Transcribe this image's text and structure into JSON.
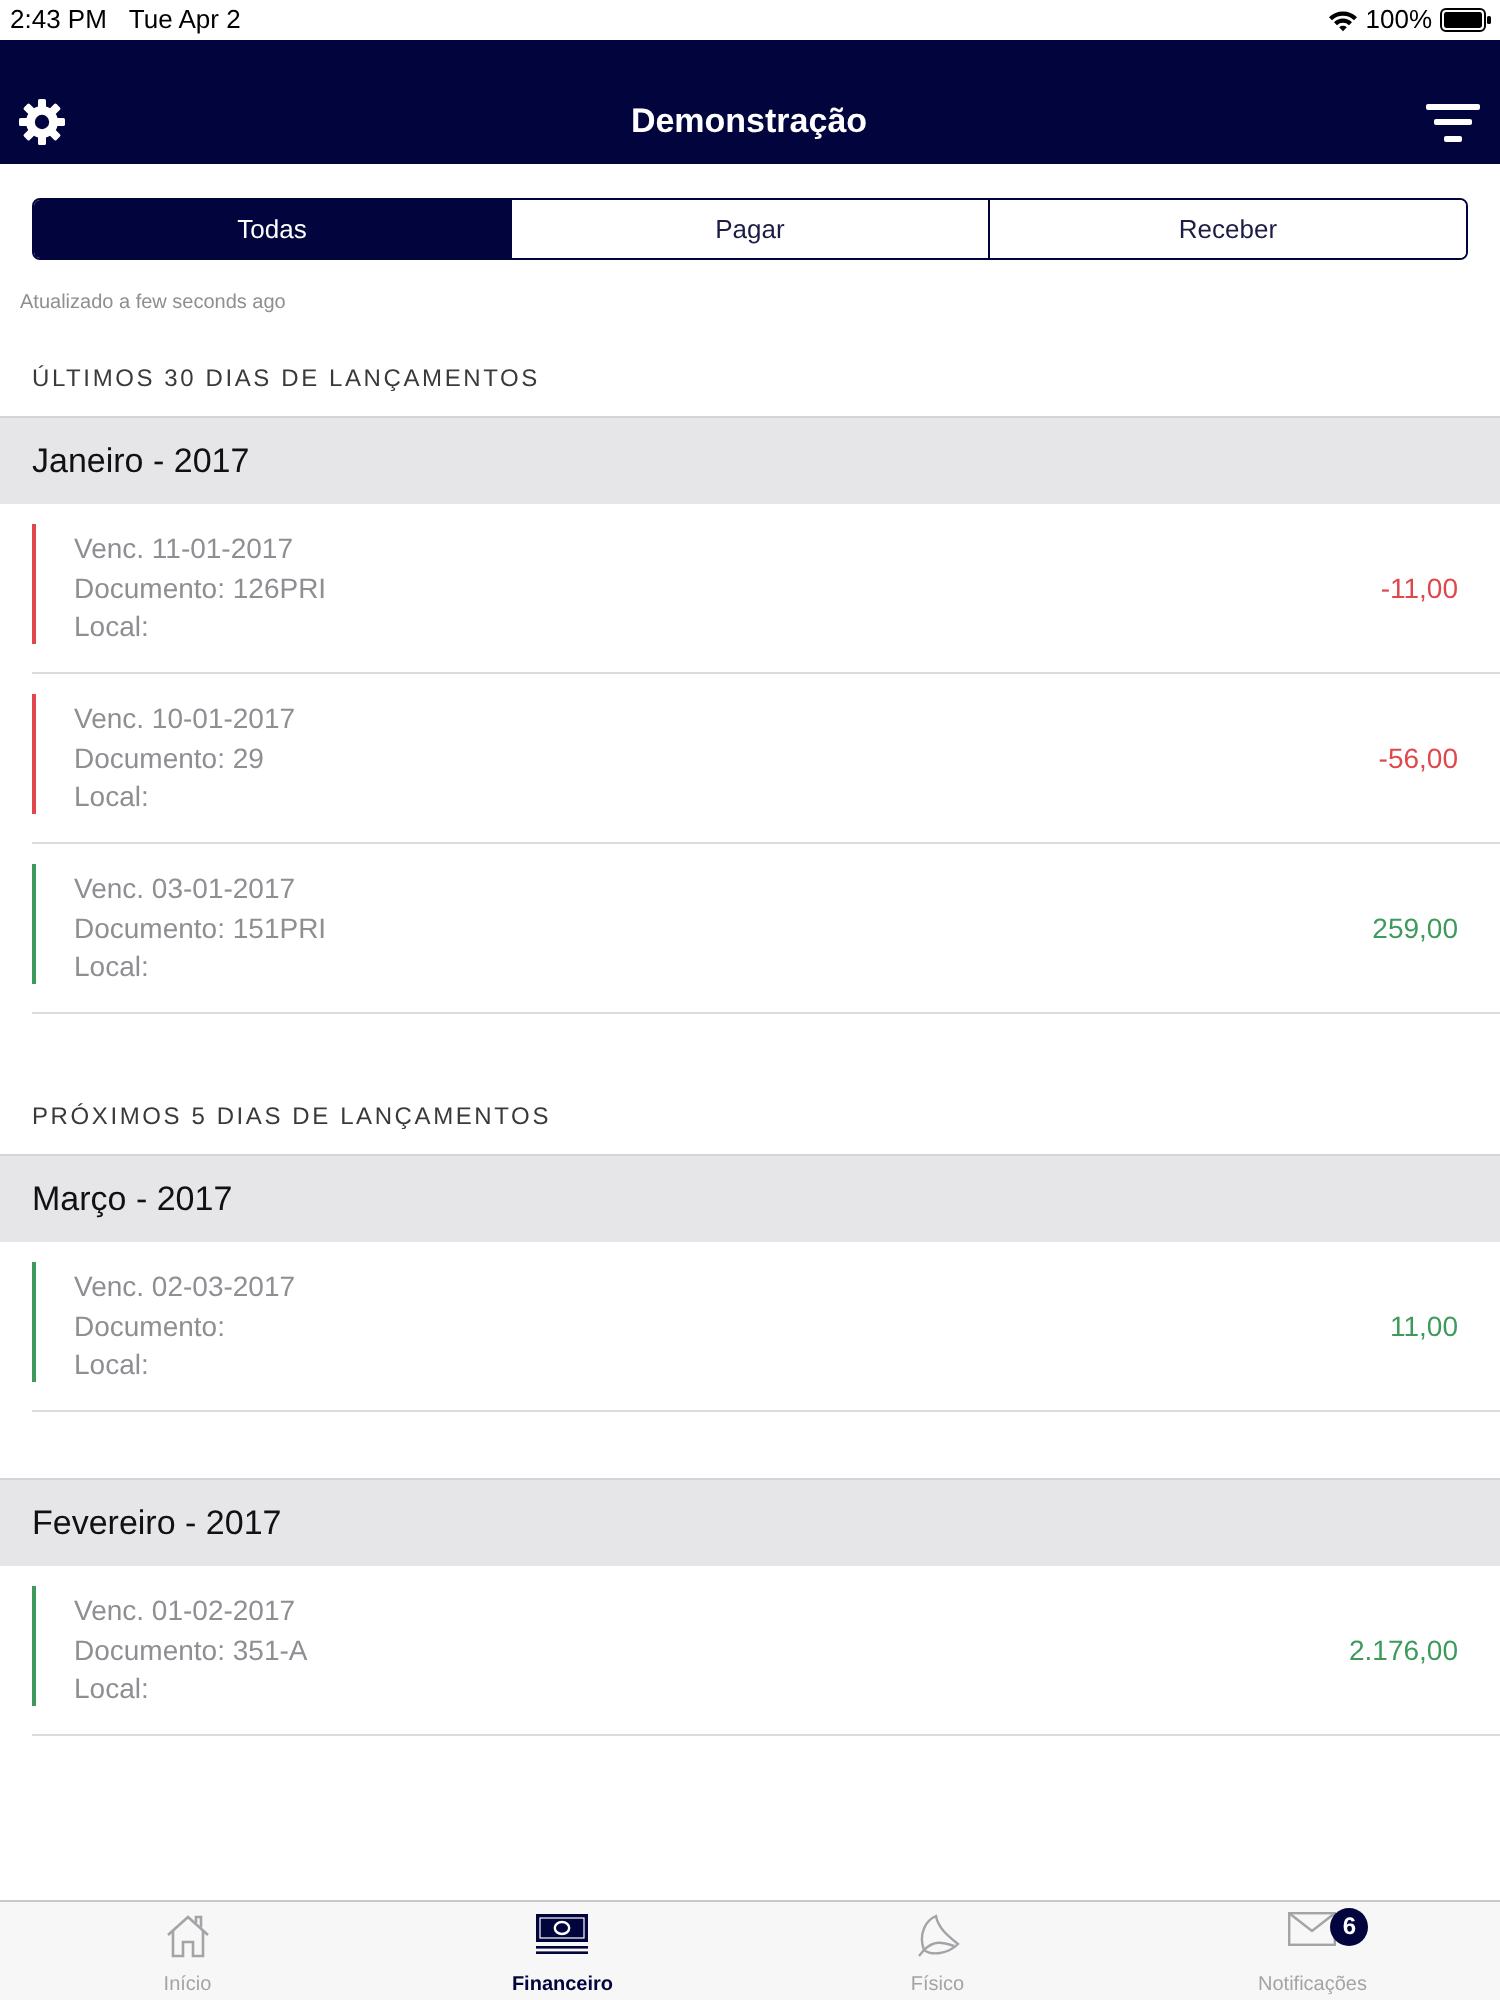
{
  "status_bar": {
    "time": "2:43 PM",
    "date": "Tue Apr 2",
    "battery": "100%"
  },
  "nav_bar": {
    "title": "Demonstração"
  },
  "segments": [
    {
      "label": "Todas",
      "selected": true
    },
    {
      "label": "Pagar",
      "selected": false
    },
    {
      "label": "Receber",
      "selected": false
    }
  ],
  "updated": "Atualizado a few seconds ago",
  "sections": [
    {
      "title": "ÚLTIMOS 30 DIAS DE LANÇAMENTOS",
      "groups": [
        {
          "title": "Janeiro - 2017",
          "entries": [
            {
              "due": "Venc. 11-01-2017",
              "document": "Documento: 126PRI",
              "local": "Local:",
              "amount": "-11,00",
              "color": "#e0474c"
            },
            {
              "due": "Venc. 10-01-2017",
              "document": "Documento: 29",
              "local": "Local:",
              "amount": "-56,00",
              "color": "#e0474c"
            },
            {
              "due": "Venc. 03-01-2017",
              "document": "Documento: 151PRI",
              "local": "Local:",
              "amount": "259,00",
              "color": "#3e9a5c"
            }
          ]
        }
      ]
    },
    {
      "title": "PRÓXIMOS 5 DIAS DE LANÇAMENTOS",
      "groups": [
        {
          "title": "Março - 2017",
          "entries": [
            {
              "due": "Venc. 02-03-2017",
              "document": "Documento:",
              "local": "Local:",
              "amount": "11,00",
              "color": "#3e9a5c"
            }
          ]
        },
        {
          "title": "Fevereiro - 2017",
          "entries": [
            {
              "due": "Venc. 01-02-2017",
              "document": "Documento: 351-A",
              "local": "Local:",
              "amount": "2.176,00",
              "color": "#3e9a5c"
            }
          ]
        }
      ]
    }
  ],
  "tab_bar": [
    {
      "label": "Início",
      "selected": false
    },
    {
      "label": "Financeiro",
      "selected": true
    },
    {
      "label": "Físico",
      "selected": false
    },
    {
      "label": "Notificações",
      "selected": false,
      "badge": "6"
    }
  ]
}
